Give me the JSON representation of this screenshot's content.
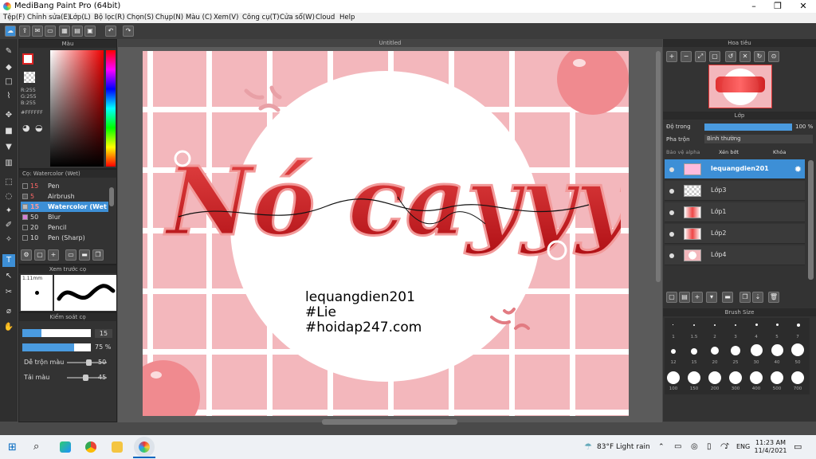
{
  "window": {
    "title": "MediBang Paint Pro (64bit)"
  },
  "menu": [
    "Tệp(F)",
    "Chỉnh sửa(E)",
    "Lớp(L)",
    "Bộ lọc(R)",
    "Chọn(S)",
    "Chụp(N)",
    "Màu (C)",
    "Xem(V)",
    "Công cụ(T)",
    "Cửa sổ(W)",
    "Cloud",
    "Help"
  ],
  "color_panel": {
    "title": "Màu",
    "r": "R:255",
    "g": "G:255",
    "b": "B:255",
    "hex": "#FFFFFF"
  },
  "brush_panel": {
    "title": "Cọ: Watercolor (Wet)",
    "items": [
      {
        "size": "15",
        "name": "Pen",
        "color": "#333333"
      },
      {
        "size": "5",
        "name": "Airbrush",
        "color": "#555555"
      },
      {
        "size": "15",
        "name": "Watercolor (Wet)",
        "color": "#bbbbbb",
        "selected": true
      },
      {
        "size": "50",
        "name": "Blur",
        "color": "#d47fd4"
      },
      {
        "size": "20",
        "name": "Pencil",
        "color": "#333333"
      },
      {
        "size": "10",
        "name": "Pen (Sharp)",
        "color": "#333333"
      }
    ]
  },
  "preview_panel": {
    "title": "Xem trước cọ",
    "size": "1.11mm"
  },
  "control_panel": {
    "title": "Kiểm soát cọ",
    "width": "15",
    "opacity": "75 %",
    "opacity_value": 0.75,
    "blend_label": "Dễ trộn màu",
    "blend": "50",
    "reload_label": "Tải màu",
    "reload": "45"
  },
  "canvas": {
    "tab": "Untitled",
    "line1": "lequangdien201",
    "line2": "#Lie",
    "line3": "#hoidap247.com",
    "lettering": "Nó cayyy"
  },
  "navigator": {
    "title": "Hoa tiêu"
  },
  "layer_panel": {
    "title": "Lớp",
    "opacity_label": "Độ trong",
    "opacity": "100 %",
    "blend_label": "Pha trộn",
    "blend": "Bình thường",
    "protect_alpha": "Bảo vệ alpha",
    "clip": "Xén bớt",
    "lock": "Khóa",
    "layers": [
      {
        "name": "lequangdien201",
        "selected": true
      },
      {
        "name": "Lớp3"
      },
      {
        "name": "Lớp1"
      },
      {
        "name": "Lớp2"
      },
      {
        "name": "Lớp4"
      }
    ]
  },
  "brush_size_panel": {
    "title": "Brush Size",
    "sizes": [
      "1",
      "1.5",
      "2",
      "3",
      "4",
      "5",
      "7",
      "12",
      "15",
      "20",
      "25",
      "30",
      "40",
      "50",
      "100",
      "150",
      "200",
      "300",
      "400",
      "500",
      "700"
    ]
  },
  "taskbar": {
    "weather": "83°F  Light rain",
    "lang": "ENG",
    "time": "11:23 AM",
    "date": "11/4/2021"
  }
}
